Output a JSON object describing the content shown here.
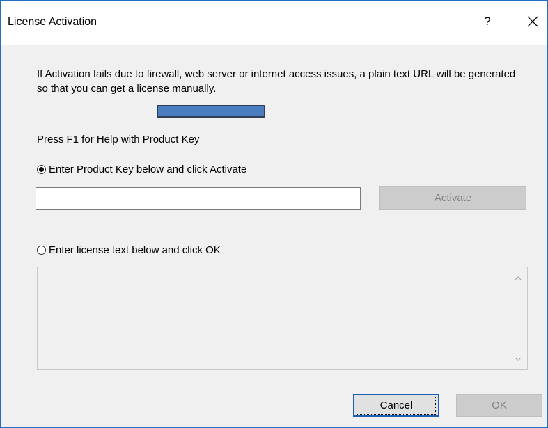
{
  "window": {
    "title": "License Activation",
    "help_label": "?",
    "close_label": "✕"
  },
  "content": {
    "message": "If Activation fails due to firewall, web server or internet access issues, a plain text URL will be generated so that you can get a license manually.",
    "f1_help": "Press F1 for Help with Product Key",
    "option_product_key": {
      "label": "Enter Product Key below and click Activate",
      "checked": true
    },
    "product_key_input": {
      "value": "",
      "placeholder": ""
    },
    "activate_label": "Activate",
    "option_license_text": {
      "label": "Enter license text below and click OK",
      "checked": false
    },
    "license_text_value": ""
  },
  "footer": {
    "cancel_label": "Cancel",
    "ok_label": "OK"
  },
  "colors": {
    "accent": "#1f6fc4",
    "redaction": "#4a7cc0",
    "disabled_button": "#cccccc"
  }
}
